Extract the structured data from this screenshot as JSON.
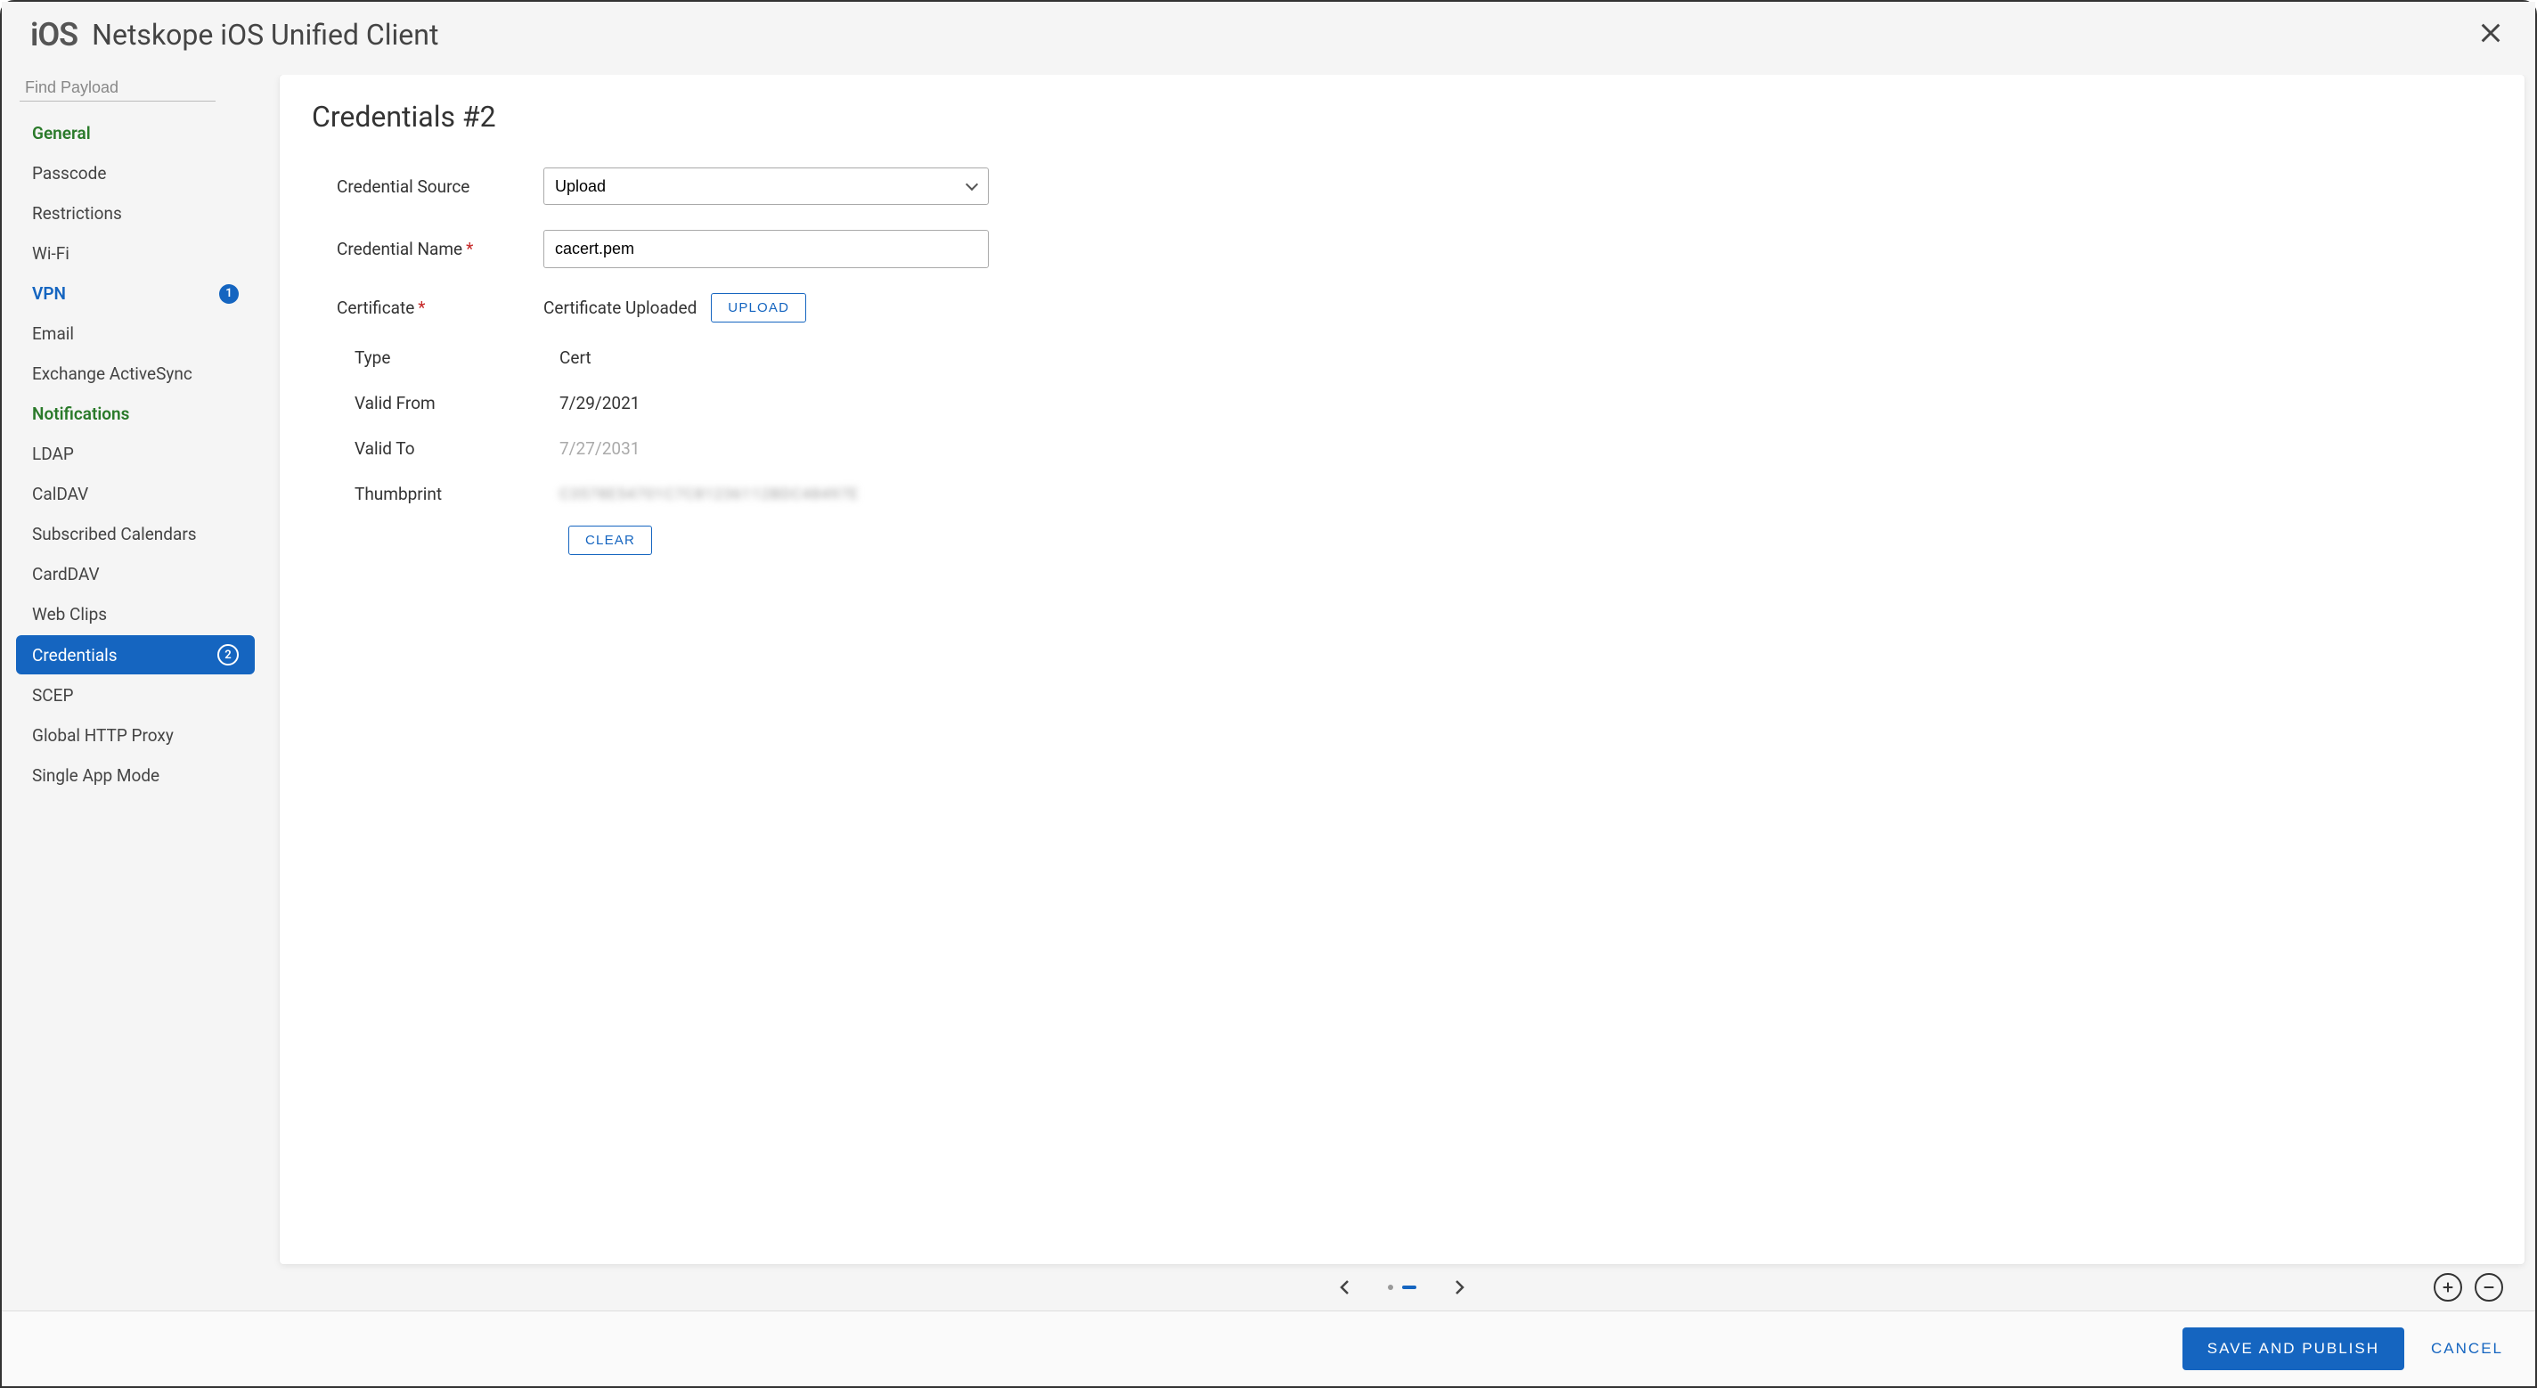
{
  "header": {
    "ios_badge": "iOS",
    "title": "Netskope iOS Unified Client"
  },
  "sidebar": {
    "search_placeholder": "Find Payload",
    "items": [
      {
        "label": "General",
        "style": "green"
      },
      {
        "label": "Passcode",
        "style": "normal"
      },
      {
        "label": "Restrictions",
        "style": "normal"
      },
      {
        "label": "Wi-Fi",
        "style": "normal"
      },
      {
        "label": "VPN",
        "style": "active-blue",
        "badge": "1"
      },
      {
        "label": "Email",
        "style": "normal"
      },
      {
        "label": "Exchange ActiveSync",
        "style": "normal"
      },
      {
        "label": "Notifications",
        "style": "green"
      },
      {
        "label": "LDAP",
        "style": "normal"
      },
      {
        "label": "CalDAV",
        "style": "normal"
      },
      {
        "label": "Subscribed Calendars",
        "style": "normal"
      },
      {
        "label": "CardDAV",
        "style": "normal"
      },
      {
        "label": "Web Clips",
        "style": "normal"
      },
      {
        "label": "Credentials",
        "style": "selected",
        "badge_outline": "2"
      },
      {
        "label": "SCEP",
        "style": "normal"
      },
      {
        "label": "Global HTTP Proxy",
        "style": "normal"
      },
      {
        "label": "Single App Mode",
        "style": "normal"
      }
    ]
  },
  "panel": {
    "title": "Credentials #2",
    "labels": {
      "credential_source": "Credential Source",
      "credential_name": "Credential Name",
      "certificate": "Certificate",
      "type": "Type",
      "valid_from": "Valid From",
      "valid_to": "Valid To",
      "thumbprint": "Thumbprint"
    },
    "values": {
      "credential_source": "Upload",
      "credential_name": "cacert.pem",
      "certificate_status": "Certificate Uploaded",
      "type": "Cert",
      "valid_from": "7/29/2021",
      "valid_to": "7/27/2031",
      "thumbprint": "C3578E54701C7C81236112BDC48497E"
    },
    "buttons": {
      "upload": "UPLOAD",
      "clear": "CLEAR"
    }
  },
  "footer": {
    "save_publish": "SAVE AND PUBLISH",
    "cancel": "CANCEL"
  }
}
